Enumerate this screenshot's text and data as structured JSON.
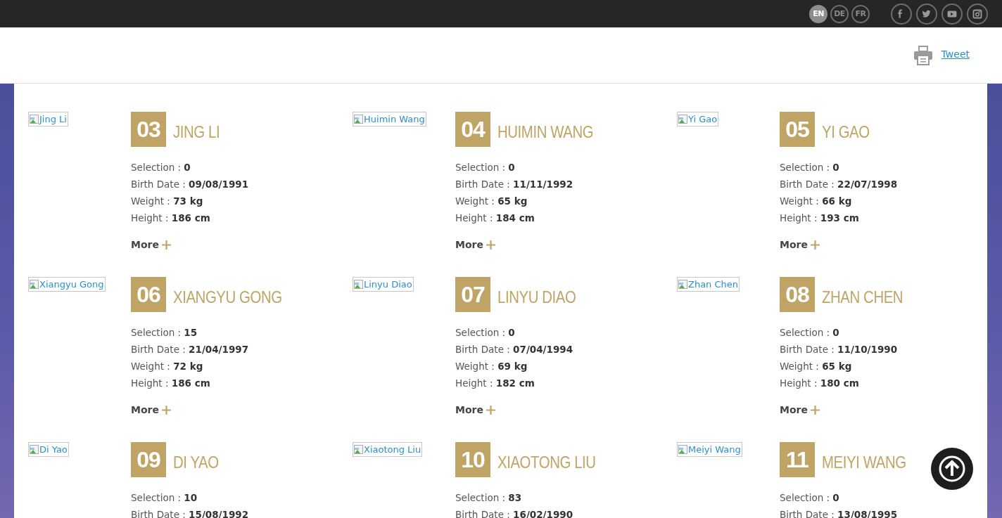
{
  "top_bar": {
    "languages": [
      {
        "label": "EN",
        "selected": true
      },
      {
        "label": "DE",
        "selected": false
      },
      {
        "label": "FR",
        "selected": false
      }
    ],
    "social": [
      {
        "kind": "facebook"
      },
      {
        "kind": "twitter"
      },
      {
        "kind": "youtube"
      },
      {
        "kind": "instagram"
      }
    ]
  },
  "header": {
    "tweet_link": "Tweet"
  },
  "players": [
    {
      "photo_alt": "Jing Li",
      "number": "03",
      "name": "JING LI",
      "stats": [
        "Selection : **0**",
        "Birth Date : **09/08/1991**",
        "Weight : **73 kg**",
        "Height : **186 cm**"
      ],
      "more": "More"
    },
    {
      "photo_alt": "Huimin Wang",
      "number": "04",
      "name": "HUIMIN WANG",
      "stats": [
        "Selection : **0**",
        "Birth Date : **11/11/1992**",
        "Weight : **65 kg**",
        "Height : **184 cm**"
      ],
      "more": "More"
    },
    {
      "photo_alt": "Yi Gao",
      "number": "05",
      "name": "YI GAO",
      "stats": [
        "Selection : **0**",
        "Birth Date : **22/07/1998**",
        "Weight : **66 kg**",
        "Height : **193 cm**"
      ],
      "more": "More"
    },
    {
      "photo_alt": "Xiangyu Gong",
      "number": "06",
      "name": "XIANGYU GONG",
      "stats": [
        "Selection : **15**",
        "Birth Date : **21/04/1997**",
        "Weight : **72 kg**",
        "Height : **186 cm**"
      ],
      "more": "More"
    },
    {
      "photo_alt": "Linyu Diao",
      "number": "07",
      "name": "LINYU DIAO",
      "stats": [
        "Selection : **0**",
        "Birth Date : **07/04/1994**",
        "Weight : **69 kg**",
        "Height : **182 cm**"
      ],
      "more": "More"
    },
    {
      "photo_alt": "Zhan Chen",
      "number": "08",
      "name": "ZHAN CHEN",
      "stats": [
        "Selection : **0**",
        "Birth Date : **11/10/1990**",
        "Weight : **65 kg**",
        "Height : **180 cm**"
      ],
      "more": "More"
    },
    {
      "photo_alt": "Di Yao",
      "number": "09",
      "name": "DI YAO",
      "stats": [
        "Selection : **10**",
        "Birth Date : **15/08/1992**"
      ]
    },
    {
      "photo_alt": "Xiaotong Liu",
      "number": "10",
      "name": "XIAOTONG LIU",
      "stats": [
        "Selection : **83**",
        "Birth Date : **16/02/1990**"
      ]
    },
    {
      "photo_alt": "Meiyi Wang",
      "number": "11",
      "name": "MEIYI WANG",
      "stats": [
        "Selection : **0**",
        "Birth Date : **13/08/1995**"
      ]
    }
  ]
}
